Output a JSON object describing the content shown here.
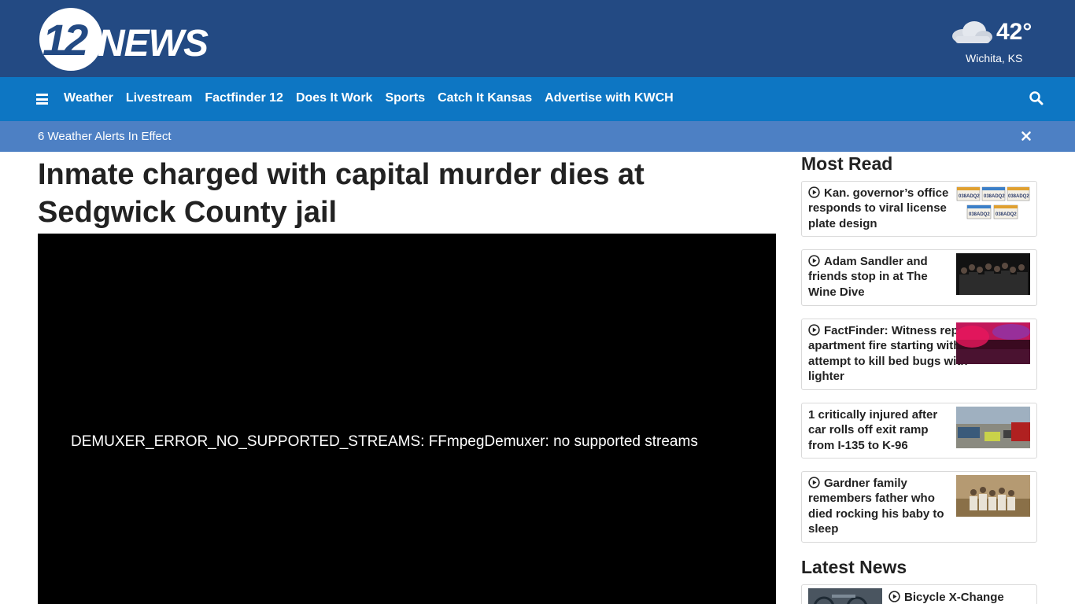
{
  "header": {
    "logo_text": "12NEWS",
    "weather": {
      "icon": "cloud-icon",
      "temperature": "42°",
      "city": "Wichita, KS"
    }
  },
  "nav": {
    "menu_icon": "hamburger-icon",
    "links": [
      "Weather",
      "Livestream",
      "Factfinder 12",
      "Does It Work",
      "Sports",
      "Catch It Kansas",
      "Advertise with KWCH"
    ],
    "search_icon": "search-icon"
  },
  "alert": {
    "text": "6 Weather Alerts In Effect",
    "close_icon": "close-icon"
  },
  "article": {
    "headline": "Inmate charged with capital murder dies at Sedgwick County jail",
    "video_error": "DEMUXER_ERROR_NO_SUPPORTED_STREAMS: FFmpegDemuxer: no supported streams"
  },
  "most_read": {
    "title": "Most Read",
    "items": [
      {
        "text": "Kan. governor’s office responds to viral license plate design",
        "video": true
      },
      {
        "text": "Adam Sandler and friends stop in at The Wine Dive",
        "video": true
      },
      {
        "text": "FactFinder: Witness reports apartment fire starting with attempt to kill bed bugs with lighter",
        "video": true
      },
      {
        "text": "1 critically injured after car rolls off exit ramp from I-135 to K-96",
        "video": false
      },
      {
        "text": "Gardner family remembers father who died rocking his baby to sleep",
        "video": true
      }
    ],
    "plate_text": "038ADQ2"
  },
  "latest_news": {
    "title": "Latest News",
    "items": [
      {
        "text": "Bicycle X-Change",
        "video": true
      }
    ]
  },
  "colors": {
    "header": "#234a83",
    "nav": "#0d76c3",
    "alert": "#4d80c4"
  }
}
